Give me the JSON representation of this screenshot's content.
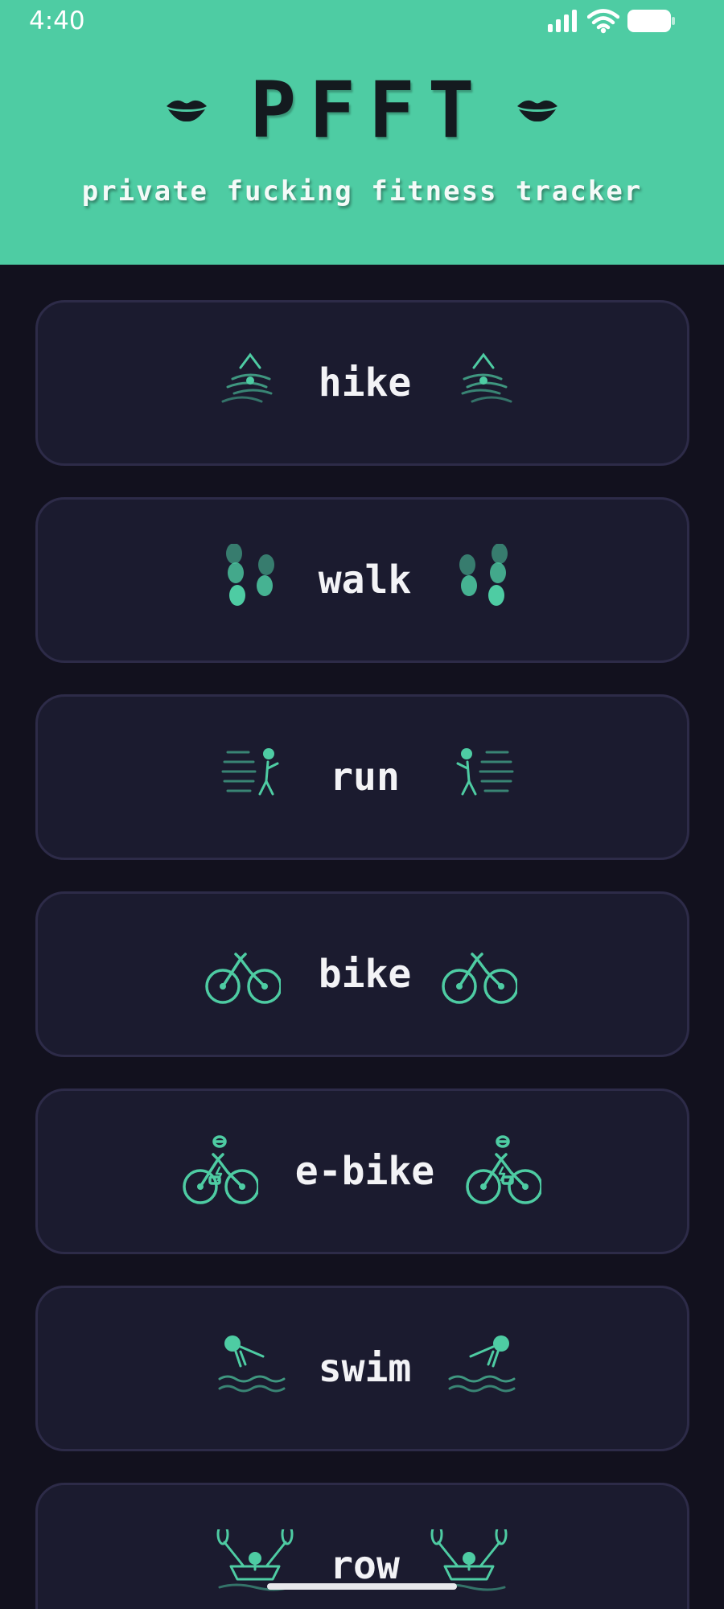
{
  "status_bar": {
    "time": "4:40"
  },
  "header": {
    "title": "PFFT",
    "subtitle": "private fucking fitness tracker",
    "accent_color": "#4ecca3",
    "icon": "lips-icon"
  },
  "activities": [
    {
      "label": "hike",
      "icon": "hike-icon"
    },
    {
      "label": "walk",
      "icon": "footprints-icon"
    },
    {
      "label": "run",
      "icon": "runner-icon"
    },
    {
      "label": "bike",
      "icon": "bicycle-icon"
    },
    {
      "label": "e-bike",
      "icon": "e-bike-icon"
    },
    {
      "label": "swim",
      "icon": "swimmer-icon"
    },
    {
      "label": "row",
      "icon": "rowing-icon"
    }
  ]
}
